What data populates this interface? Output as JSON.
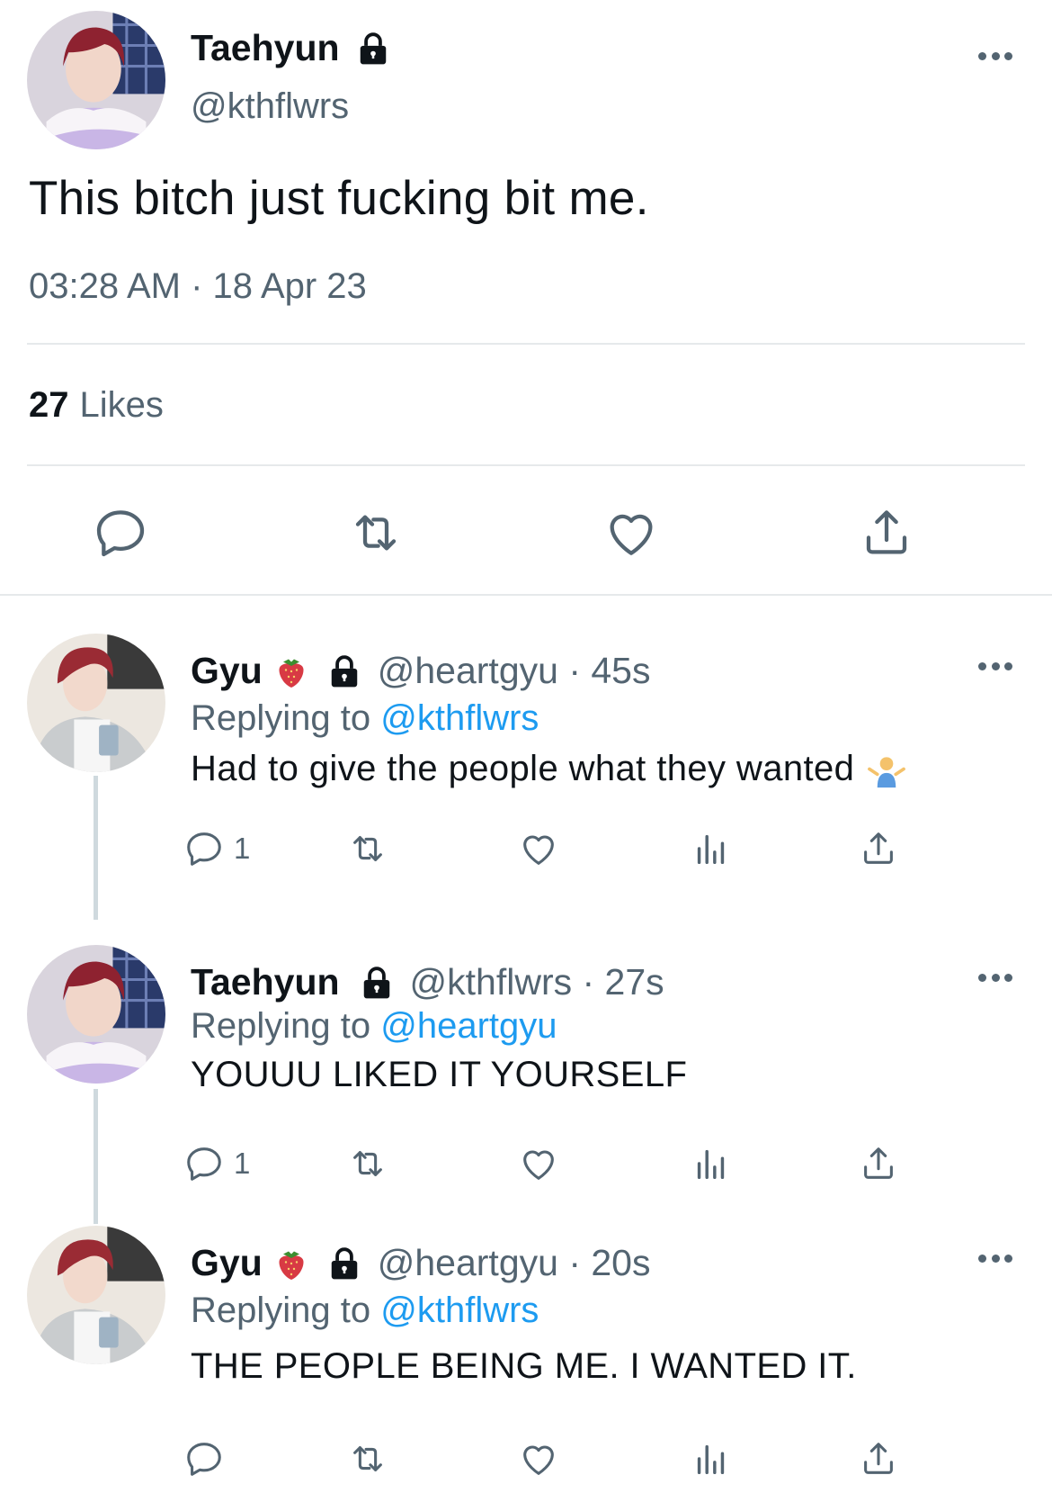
{
  "main_tweet": {
    "author_name": "Taehyun",
    "author_handle": "@kthflwrs",
    "text": "This bitch just fucking bit me.",
    "timestamp": "03:28 AM · 18 Apr 23",
    "likes_count": "27",
    "likes_label": "Likes",
    "protected": true
  },
  "replies": [
    {
      "author_name": "Gyu",
      "emoji": "strawberry-icon",
      "handle_time": "@heartgyu · 45s",
      "replying_prefix": "Replying to ",
      "replying_to": "@kthflwrs",
      "text": "Had to give the people what they wanted",
      "trailing_emoji": "person-shrugging-icon",
      "reply_count": "1"
    },
    {
      "author_name": "Taehyun",
      "emoji": "",
      "handle_time": "@kthflwrs · 27s",
      "replying_prefix": "Replying to ",
      "replying_to": "@heartgyu",
      "text": "YOUUU LIKED IT YOURSELF",
      "reply_count": "1"
    },
    {
      "author_name": "Gyu",
      "emoji": "strawberry-icon",
      "handle_time": "@heartgyu · 20s",
      "replying_prefix": "Replying to ",
      "replying_to": "@kthflwrs",
      "text": "THE PEOPLE BEING ME. I WANTED IT.",
      "reply_count": ""
    }
  ],
  "colors": {
    "text_primary": "#0f1419",
    "text_secondary": "#536471",
    "mention": "#1d9bf0",
    "divider": "#e6e9eb",
    "thread_line": "#cfd9de"
  }
}
